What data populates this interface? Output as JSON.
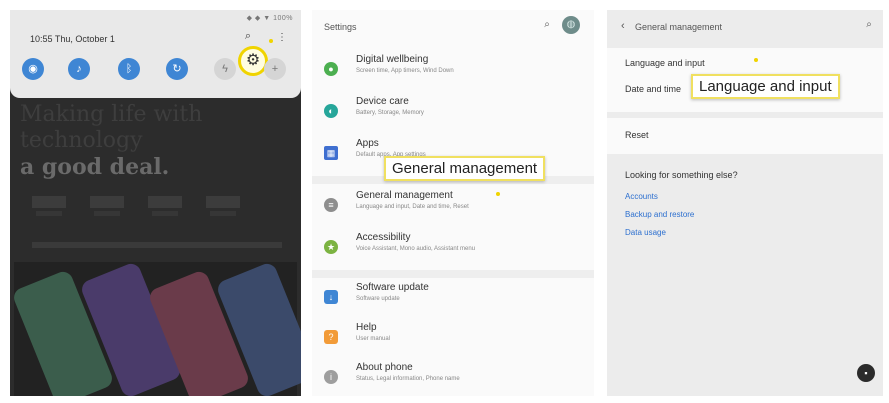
{
  "quick_panel": {
    "time_date": "10:55 Thu, October 1",
    "status_icons": "◆ ◆ ▼ 100%",
    "search_icon": "search-icon",
    "more_icon": "more-options-icon",
    "settings_icon": "gear-icon",
    "tiles": [
      "wifi-icon",
      "sound-icon",
      "bluetooth-icon",
      "rotate-icon",
      "flashlight-icon",
      "plus-icon"
    ],
    "accent_color": "#3f86d4",
    "highlight_color": "#f0d400"
  },
  "background_article": {
    "headline": "Making life with technology",
    "headline_bold": "a good deal."
  },
  "settings": {
    "title": "Settings",
    "items": [
      {
        "title": "Digital wellbeing",
        "subtitle": "Screen time, App timers, Wind Down",
        "icon": "wellbeing-icon",
        "color": "#4caf50"
      },
      {
        "title": "Device care",
        "subtitle": "Battery, Storage, Memory",
        "icon": "device-care-icon",
        "color": "#26a69a"
      },
      {
        "title": "Apps",
        "subtitle": "Default apps, App settings",
        "icon": "apps-icon",
        "color": "#3f6fd0"
      },
      {
        "title": "General management",
        "subtitle": "Language and input, Date and time, Reset",
        "icon": "general-management-icon",
        "color": "#8e8e8e"
      },
      {
        "title": "Accessibility",
        "subtitle": "Voice Assistant, Mono audio, Assistant menu",
        "icon": "accessibility-icon",
        "color": "#7cb342"
      },
      {
        "title": "Software update",
        "subtitle": "Software update",
        "icon": "software-update-icon",
        "color": "#3f86d4"
      },
      {
        "title": "Help",
        "subtitle": "User manual",
        "icon": "help-icon",
        "color": "#f29b38"
      },
      {
        "title": "About phone",
        "subtitle": "Status, Legal information, Phone name",
        "icon": "about-phone-icon",
        "color": "#9e9e9e"
      }
    ],
    "callout": "General management"
  },
  "general_management": {
    "title": "General management",
    "items": [
      "Language and input",
      "Date and time",
      "Reset"
    ],
    "looking_for": "Looking for something else?",
    "links": [
      "Accounts",
      "Backup and restore",
      "Data usage"
    ],
    "callout": "Language and input",
    "link_color": "#2c6fcf"
  }
}
